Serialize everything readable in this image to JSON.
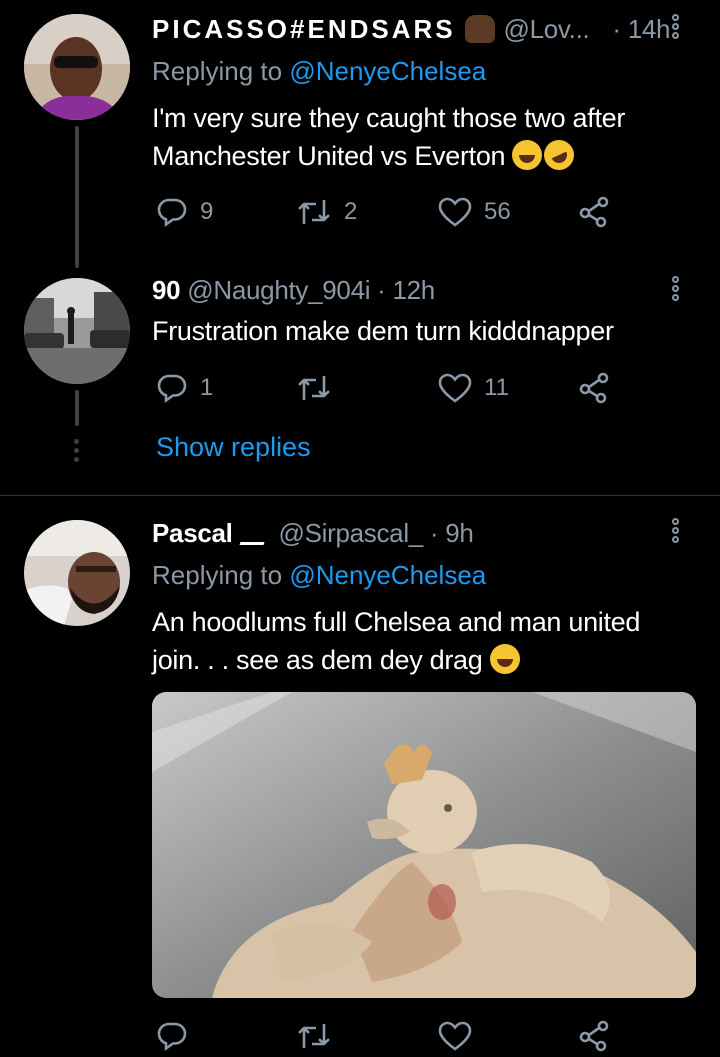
{
  "tweets": [
    {
      "display_name": "PICASSO#ENDSARS",
      "name_emoji": "✊🏿",
      "handle": "@Lov...",
      "time": "· 14h",
      "replying_prefix": "Replying to",
      "replying_to": "@NenyeChelsea",
      "text_line1": "I'm very sure they caught those two after",
      "text_line2": "Manchester United vs Everton",
      "reply_count": "9",
      "retweet_count": "2",
      "like_count": "56"
    },
    {
      "display_name": "90",
      "handle": "@Naughty_904i",
      "time": "· 12h",
      "text": "Frustration make dem turn kidddnapper",
      "reply_count": "1",
      "retweet_count": "",
      "like_count": "11"
    },
    {
      "display_name": "Pascal",
      "name_emoji": "✍",
      "handle": "@Sirpascal_",
      "time": "· 9h",
      "replying_prefix": "Replying to",
      "replying_to": "@NenyeChelsea",
      "text_line1": "An hoodlums full Chelsea and man united",
      "text_line2": "join. . . see as dem dey drag",
      "reply_count": "",
      "retweet_count": "",
      "like_count": ""
    }
  ],
  "show_replies": "Show replies",
  "colors": {
    "background": "#000000",
    "secondary_text": "#8b98a5",
    "link": "#1d9bf0",
    "divider": "#2f3336",
    "thread_line": "#3d4145"
  },
  "icons": [
    "reply-icon",
    "retweet-icon",
    "like-icon",
    "share-icon",
    "more-options-icon"
  ]
}
